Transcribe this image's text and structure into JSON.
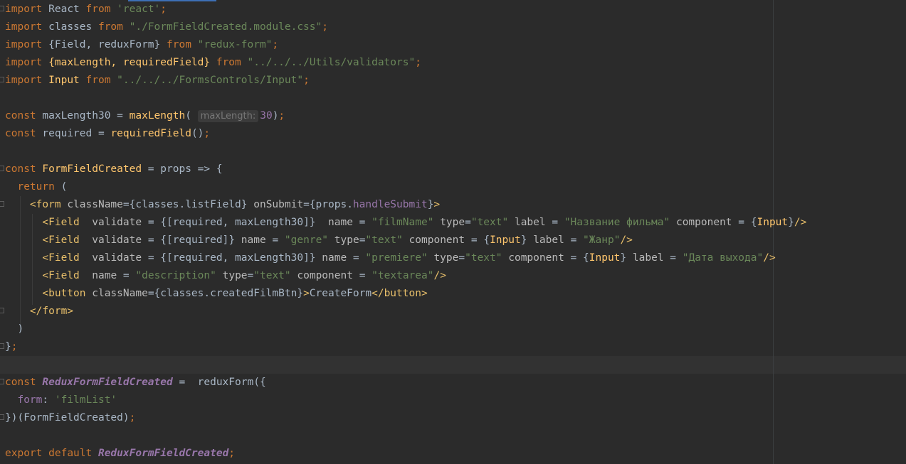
{
  "editor": {
    "language": "javascript-jsx",
    "hint_label": "maxLength:",
    "tokens": {
      "import": "import",
      "from": "from",
      "const": "const",
      "return": "return",
      "export": "export",
      "default": "default",
      "react_name": "React",
      "react_path": "'react'",
      "classes_name": "classes",
      "css_path": "\"./FormFieldCreated.module.css\"",
      "field_redux": "{Field, reduxForm}",
      "redux_form_path": "\"redux-form\"",
      "validators_names": "{maxLength, requiredField}",
      "validators_path": "\"../../../Utils/validators\"",
      "input_name": "Input",
      "input_path": "\"../../../FormsControls/Input\"",
      "max_len_30": "maxLength30",
      "max_len_fn": "maxLength",
      "num_30": "30",
      "required": "required",
      "required_field_fn": "requiredField",
      "form_field_created": "FormFieldCreated",
      "props": "props",
      "redux_form_field_created": "ReduxFormFieldCreated",
      "redux_form_fn": "reduxForm",
      "form_key": "form",
      "film_list": "'filmList'",
      "form_open": "<form",
      "class_name": "className",
      "list_field": "{classes.listField}",
      "on_submit": "onSubmit",
      "handle_submit": "handleSubmit",
      "field_tag": "<Field",
      "validate": "validate",
      "name": "name",
      "type": "type",
      "label": "label",
      "component": "component",
      "film_name": "\"filmName\"",
      "text_val": "\"text\"",
      "film_title_label": "\"Название фильма\"",
      "genre": "\"genre\"",
      "genre_label": "\"Жанр\"",
      "premiere": "\"premiere\"",
      "release_label": "\"Дата выхода\"",
      "description": "\"description\"",
      "textarea": "\"textarea\"",
      "button_open": "<button",
      "created_film_btn": "{classes.createdFilmBtn}",
      "create_form": "CreateForm",
      "button_close": "</button>",
      "form_close": "</form>"
    }
  }
}
